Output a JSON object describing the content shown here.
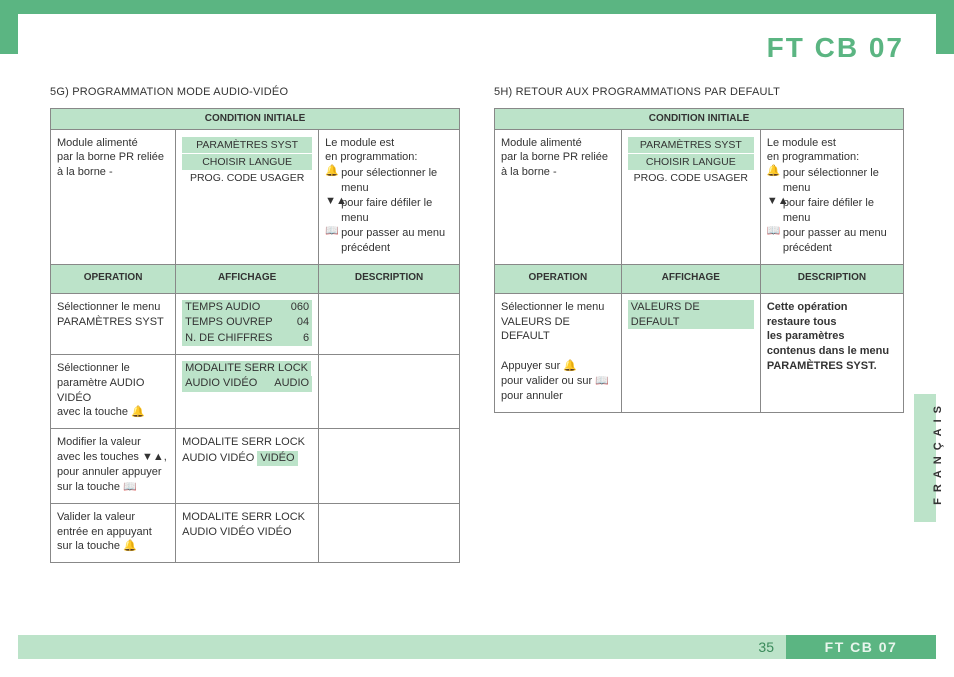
{
  "header": {
    "title": "FT CB 07"
  },
  "footer": {
    "page": "35",
    "label": "FT CB 07"
  },
  "side_tab": "FRANÇAIS",
  "common": {
    "cond_initiale": "CONDITION INITIALE",
    "operation": "OPERATION",
    "affichage": "AFFICHAGE",
    "description": "DESCRIPTION",
    "module_text": "Module alimenté\npar la borne PR reliée\nà la borne -",
    "disp1": "PARAMÈTRES SYST",
    "disp2": "CHOISIR LANGUE",
    "disp3": "PROG. CODE USAGER",
    "desc_intro": "Le module est\nen programmation:",
    "desc_bell": "pour sélectionner le menu",
    "desc_arrows": "pour faire défiler le menu",
    "desc_book": "pour passer au menu",
    "desc_book2": "précédent"
  },
  "left": {
    "title": "5G) PROGRAMMATION MODE AUDIO-VIDÉO",
    "rows": [
      {
        "op": "Sélectionner le menu\nPARAMÈTRES SYST",
        "aff_lines": [
          {
            "l": "TEMPS AUDIO",
            "r": "060"
          },
          {
            "l": "TEMPS OUVREP",
            "r": "04"
          },
          {
            "l": "N. DE CHIFFRES",
            "r": "6"
          }
        ],
        "desc": ""
      },
      {
        "op": "Sélectionner le\nparamètre AUDIO VIDÉO\navec la touche 🔔",
        "aff_text": [
          {
            "txt": "MODALITE SERR LOCK",
            "hl": true
          },
          {
            "prefix": "AUDIO VIDÉO",
            "suffix": "AUDIO",
            "hl_row": true
          }
        ],
        "desc": ""
      },
      {
        "op": "Modifier la valeur\navec les touches ▼▲,\npour annuler appuyer\nsur la touche 📖",
        "aff_text": [
          {
            "prefix": "MODALITE SERR",
            "suffix": "LOCK"
          },
          {
            "prefix": "AUDIO VIDÉO",
            "suffix": "VIDÉO",
            "hl_suffix": true
          }
        ],
        "desc": ""
      },
      {
        "op": "Valider la valeur\nentrée en appuyant\nsur la touche 🔔",
        "aff_text": [
          {
            "prefix": "MODALITE SERR",
            "suffix": "LOCK"
          },
          {
            "prefix": "AUDIO VIDÉO",
            "suffix": "VIDÉO"
          }
        ],
        "desc": ""
      }
    ]
  },
  "right": {
    "title": "5H) RETOUR AUX PROGRAMMATIONS PAR DEFAULT",
    "row": {
      "op": "Sélectionner le menu\nVALEURS DE DEFAULT\n\nAppuyer sur 🔔\npour valider ou sur 📖\npour annuler",
      "aff": "VALEURS DE DEFAULT",
      "desc": "Cette opération\nrestaure tous\nles paramètres\ncontenus dans le menu\nPARAMÈTRES SYST."
    }
  }
}
